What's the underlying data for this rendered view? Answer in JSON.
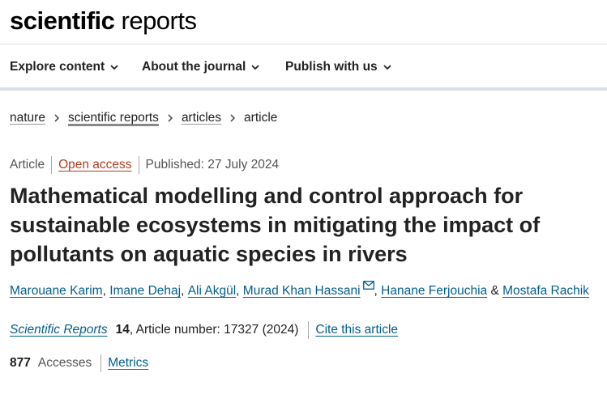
{
  "header": {
    "logo_bold": "scientific",
    "logo_light": " reports"
  },
  "nav": {
    "items": [
      {
        "label": "Explore content"
      },
      {
        "label": "About the journal"
      },
      {
        "label": "Publish with us"
      }
    ]
  },
  "breadcrumb": {
    "items": [
      "nature",
      "scientific reports",
      "articles"
    ],
    "current": "article"
  },
  "meta": {
    "type": "Article",
    "access": "Open access",
    "published": "Published: 27 July 2024"
  },
  "title": "Mathematical modelling and control approach for sustainable ecosystems in mitigating the impact of pollutants on aquatic species in rivers",
  "authors": {
    "list": [
      "Marouane Karim",
      "Imane Dehaj",
      "Ali Akgül",
      "Murad Khan Hassani",
      "Hanane Ferjouchia",
      "Mostafa Rachik"
    ],
    "separator": ", ",
    "ampersand": " & "
  },
  "citation": {
    "journal": "Scientific Reports",
    "volume": "14",
    "details": ", Article number: 17327 (2024)",
    "cite_link": "Cite this article"
  },
  "metrics": {
    "accesses_count": "877",
    "accesses_label": "Accesses",
    "metrics_link": "Metrics"
  },
  "colors": {
    "link": "#025e8d",
    "open_access": "#b43c1e",
    "nav_border": "#d9dfe5"
  }
}
